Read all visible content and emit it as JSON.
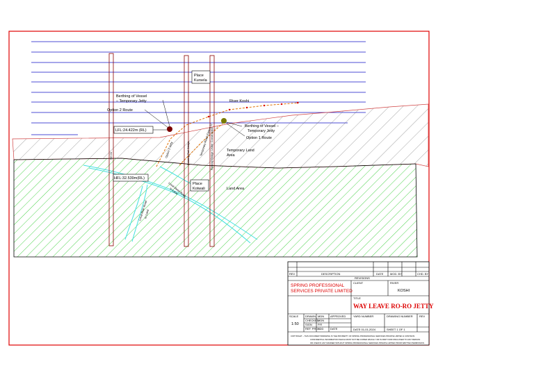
{
  "labels": {
    "place_kursela": [
      "Place",
      "Kursela"
    ],
    "berthing_temp_top": [
      "Berthing of Vessel",
      "– Temporary Jetty"
    ],
    "option2_route": "Option 2 Route",
    "river_koshi": "River Koshi",
    "lfl": "LFL:24.422m (RL)",
    "berthing_temp_right": [
      "Berthing of Vessel –",
      "Temporary Jetty"
    ],
    "option1_route": "Option 1 Route",
    "temporary_land_area": [
      "Temporary Land",
      "Area"
    ],
    "hfl": "HFL:32.539m(RL)",
    "place_kotwali": [
      "Place",
      "Kotwali"
    ],
    "land_area": "Land Area",
    "nh31": "NH 31",
    "existing_rail": "Existing Rail Bridge",
    "temporary_road": "Temporary Road (Option 1)",
    "railway_bridge": "Railway Bridge Under Construction",
    "local_metal_road": "Local Metal Road",
    "local_main_road": "Local Main Road",
    "to_land_1": "to Land",
    "to_land_2": "to Land",
    "option2_jetty": "Option 2 Jetty"
  },
  "title_block": {
    "rev": "REV",
    "description": "DESCRIPTION",
    "date": "DATE",
    "mod_by": "MOD. BY",
    "chd_by": "CHD. BY",
    "revisions": "REVISIONS",
    "company": [
      "SPRING PROFESSIONAL",
      "SERVICES PRIVATE LIMITED"
    ],
    "client_label": "CLIENT",
    "river_label": "RIVER",
    "river_value": "KOSHI",
    "title_label": "TITLE",
    "title_value": "WAY LEAVE RO-RO JETTY",
    "scale_label": "SCALE",
    "scale_value": "1:50",
    "drawn": "DRAWN",
    "checked": "CHECKED",
    "approved": "APPROVED",
    "mdn": "MDN",
    "mdn2": "MDN",
    "pr": "P.R",
    "ret_proj": "REF. PROJ.",
    "sign": "SIGN",
    "date_short": "DATE",
    "sdd": "SDD",
    "yard_number": "YARD NUMBER",
    "drawing_number": "DRAWING NUMBER",
    "rev_short": "REV",
    "issue_date": "DATE 01-01-2024",
    "sheet": "SHEET 1 OF 1",
    "copyright": [
      "COPYRIGHT – THIS DOCUMENT/DRAWING IS THE PROPERTY OF SPRING PROFESSIONAL SERVICES PRIVATE LIMITED & CONTAINS",
      "CONFIDENTIAL INFORMATION WHICH MUST NOT BE COPIED WHOLLY OR IN PART NOR DISCLOSED TO ANY PERSON",
      "OR USED IN ANY MANNER WITHOUT SPRING PROFESSIONAL SERVICES PRIVATE LIMITED PRIOR WRITTEN PERMISSION."
    ]
  },
  "colors": {
    "frame": "#e00000",
    "water_lines": "#1010c8",
    "land_hatch": "#00c000",
    "bank_hatch": "#707070",
    "road": "#40e0e0",
    "pillar": "#8b0000"
  }
}
